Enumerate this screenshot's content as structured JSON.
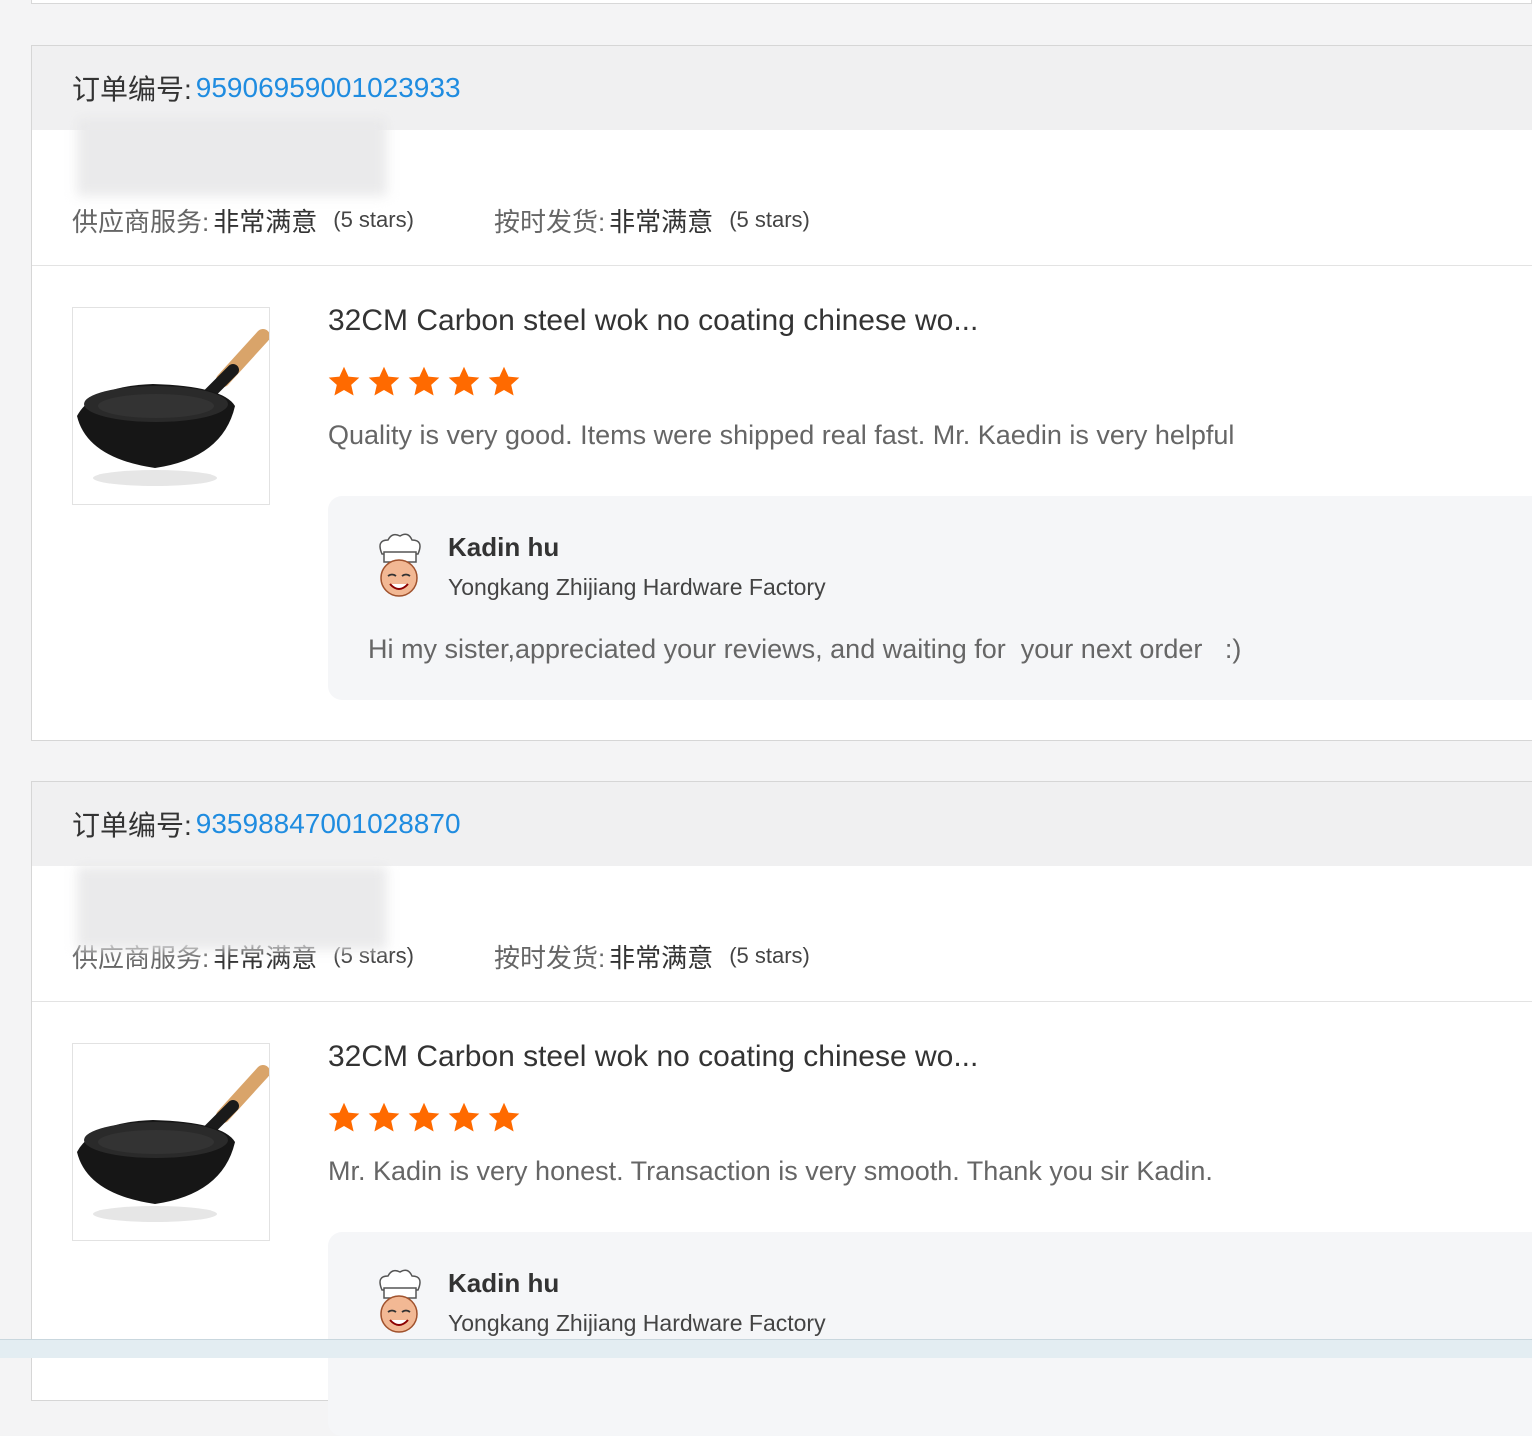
{
  "orders": [
    {
      "order_label": "订单编号:",
      "order_number": "95906959001023933",
      "supplier_service": {
        "label": "供应商服务:",
        "value": "非常满意",
        "stars_text": "(5 stars)"
      },
      "on_time_delivery": {
        "label": "按时发货:",
        "value": "非常满意",
        "stars_text": "(5 stars)"
      },
      "product_title": "32CM Carbon steel wok no coating chinese wo...",
      "rating": 5,
      "review": "Quality is very good. Items were shipped real fast. Mr. Kaedin is very helpful",
      "reply": {
        "seller_name": "Kadin hu",
        "company": "Yongkang Zhijiang Hardware Factory",
        "text": "Hi my sister,appreciated your reviews, and waiting for  your next order   :)"
      }
    },
    {
      "order_label": "订单编号:",
      "order_number": "93598847001028870",
      "supplier_service": {
        "label": "供应商服务:",
        "value": "非常满意",
        "stars_text": "(5 stars)"
      },
      "on_time_delivery": {
        "label": "按时发货:",
        "value": "非常满意",
        "stars_text": "(5 stars)"
      },
      "product_title": "32CM Carbon steel wok no coating chinese wo...",
      "rating": 5,
      "review": "Mr. Kadin is very honest. Transaction is very smooth. Thank you sir Kadin.",
      "reply": {
        "seller_name": "Kadin hu",
        "company": "Yongkang Zhijiang Hardware Factory",
        "text": ""
      }
    }
  ],
  "colors": {
    "accent": "#1f8ce0",
    "star": "#ff6a00"
  },
  "icons": {
    "star": "star-icon",
    "avatar": "chef-avatar-icon",
    "product": "wok-image"
  }
}
